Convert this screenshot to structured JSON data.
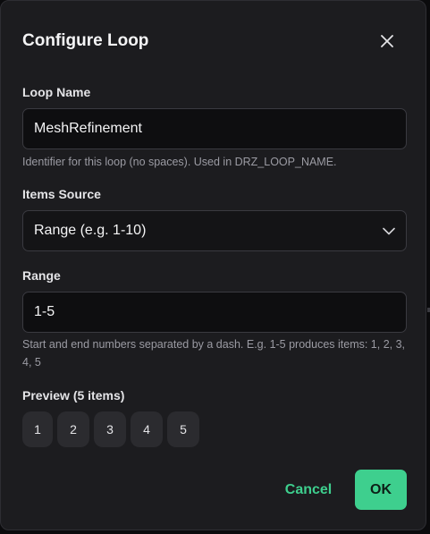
{
  "dialog": {
    "title": "Configure Loop",
    "close_icon": "close-icon"
  },
  "loop_name": {
    "label": "Loop Name",
    "value": "MeshRefinement",
    "helper": "Identifier for this loop (no spaces). Used in DRZ_LOOP_NAME."
  },
  "items_source": {
    "label": "Items Source",
    "selected": "Range (e.g. 1-10)",
    "icon": "chevron-down-icon"
  },
  "range": {
    "label": "Range",
    "value": "1-5",
    "helper": "Start and end numbers separated by a dash. E.g. 1-5 produces items: 1, 2, 3, 4, 5"
  },
  "preview": {
    "label": "Preview (5 items)",
    "items": [
      "1",
      "2",
      "3",
      "4",
      "5"
    ]
  },
  "footer": {
    "cancel_label": "Cancel",
    "ok_label": "OK"
  },
  "colors": {
    "accent": "#3ecf8e",
    "dialog_bg": "#1c1c1f",
    "input_bg": "#0e0e10"
  }
}
